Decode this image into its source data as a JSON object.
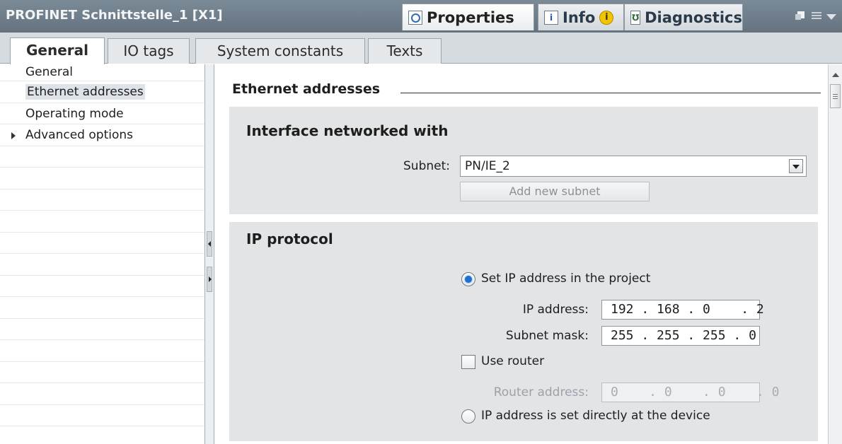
{
  "window": {
    "title": "PROFINET Schnittstelle_1 [X1]",
    "panel_tabs": [
      {
        "label": "Properties",
        "icon": "properties-icon"
      },
      {
        "label": "Info",
        "icon": "info-icon"
      },
      {
        "label": "Diagnostics",
        "icon": "diagnostics-icon"
      }
    ],
    "info_badge": "i"
  },
  "subtabs": [
    "General",
    "IO tags",
    "System constants",
    "Texts"
  ],
  "nav": {
    "items": [
      {
        "label": "General"
      },
      {
        "label": "Ethernet addresses"
      },
      {
        "label": "Operating mode"
      },
      {
        "label": "Advanced options"
      }
    ]
  },
  "main": {
    "section_title": "Ethernet addresses",
    "networked": {
      "title": "Interface networked with",
      "subnet_label": "Subnet:",
      "subnet_value": "PN/IE_2",
      "add_subnet_button": "Add new subnet"
    },
    "ip": {
      "title": "IP protocol",
      "set_in_project": "Set IP address in the project",
      "ip_label": "IP address:",
      "ip_value": "192 . 168 . 0    . 2",
      "mask_label": "Subnet mask:",
      "mask_value": "255 . 255 . 255 . 0",
      "use_router": "Use router",
      "router_label": "Router address:",
      "router_value": "0    . 0    . 0    . 0",
      "set_at_device": "IP address is set directly at the device"
    }
  },
  "colors": {
    "titlebar": "#6f7e8a",
    "group_bg": "#e2e4e6",
    "radio_selected": "#1f6fd0"
  }
}
